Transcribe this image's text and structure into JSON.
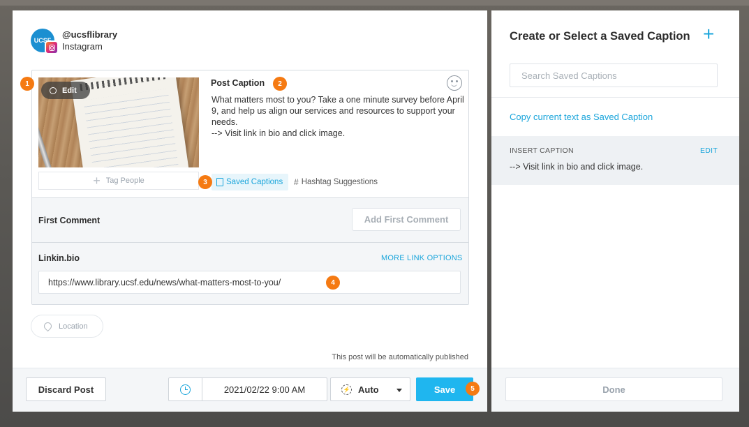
{
  "account": {
    "avatar_text": "UCSF",
    "handle": "@ucsflibrary",
    "network": "Instagram"
  },
  "post": {
    "edit_label": "Edit",
    "tag_people_label": "Tag People",
    "caption_label": "Post Caption",
    "caption_text": "What matters most to you? Take a one minute survey before April 9, and help us align our services and resources to support your needs.\n--> Visit link in bio and click image.",
    "saved_captions_label": "Saved Captions",
    "hashtag_label": "Hashtag Suggestions"
  },
  "first_comment": {
    "label": "First Comment",
    "button_label": "Add First Comment"
  },
  "linkinbio": {
    "label": "Linkin.bio",
    "more_options_label": "MORE LINK OPTIONS",
    "url_value": "https://www.library.ucsf.edu/news/what-matters-most-to-you/"
  },
  "location": {
    "label": "Location"
  },
  "publish_note": "This post will be automatically published",
  "footer": {
    "discard_label": "Discard Post",
    "datetime": "2021/02/22 9:00 AM",
    "mode_label": "Auto",
    "save_label": "Save"
  },
  "callouts": [
    "1",
    "2",
    "3",
    "4",
    "5"
  ],
  "right_panel": {
    "title": "Create or Select a Saved Caption",
    "search_placeholder": "Search Saved Captions",
    "copy_link": "Copy current text as Saved Caption",
    "insert_label": "INSERT CAPTION",
    "edit_label": "EDIT",
    "insert_text": "--> Visit link in bio and click image.",
    "done_label": "Done"
  },
  "colors": {
    "accent": "#1aa5db",
    "save_button": "#1fb6ef",
    "callout": "#f57a12",
    "instagram_gradient": "#dd2a7b"
  },
  "icons": [
    "instagram-icon",
    "sun-icon",
    "plus-icon",
    "smiley-icon",
    "document-icon",
    "hashtag-icon",
    "location-pin-icon",
    "clock-icon",
    "auto-publish-icon",
    "chevron-down-icon",
    "add-icon"
  ]
}
